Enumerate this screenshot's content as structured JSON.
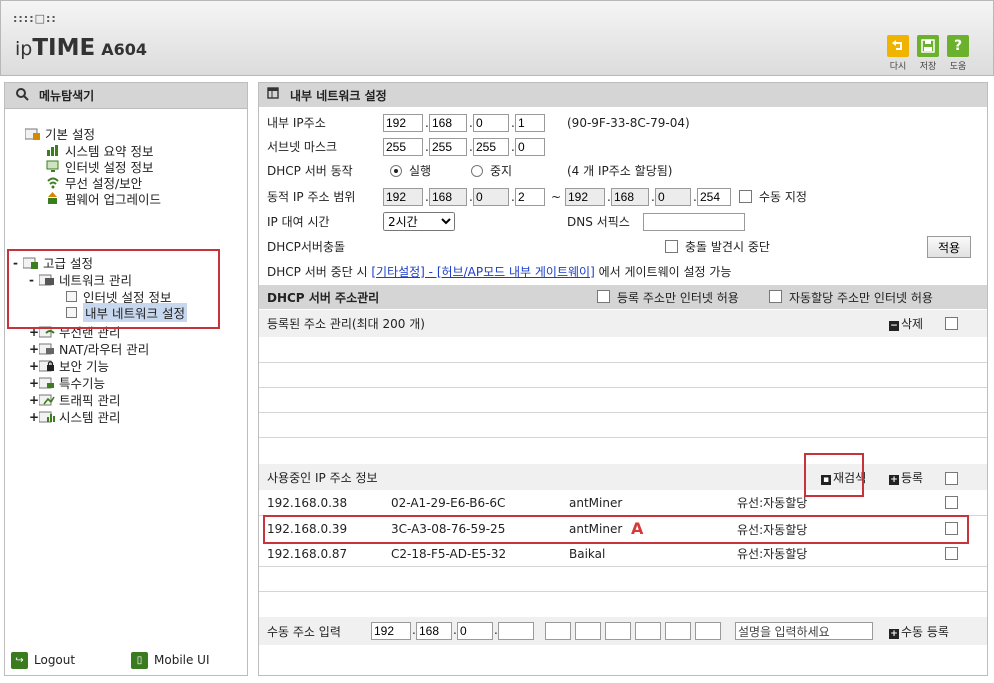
{
  "header": {
    "brand_dots": "::::□::",
    "brand_ip": "ip",
    "brand_time": "TIME",
    "brand_model": "A604",
    "buttons": [
      {
        "label": "다시",
        "icon": "undo-icon"
      },
      {
        "label": "저장",
        "icon": "save-icon"
      },
      {
        "label": "도움",
        "icon": "help-icon",
        "glyph": "?"
      }
    ]
  },
  "sidebar": {
    "title": "메뉴탐색기",
    "basic": {
      "label": "기본 설정",
      "items": [
        "시스템 요약 정보",
        "인터넷 설정 정보",
        "무선 설정/보안",
        "펌웨어 업그레이드"
      ]
    },
    "advanced": {
      "label": "고급 설정",
      "network": {
        "label": "네트워크 관리",
        "items": [
          "인터넷 설정 정보",
          "내부 네트워크 설정"
        ]
      },
      "others": [
        "무선랜 관리",
        "NAT/라우터 관리",
        "보안 기능",
        "특수기능",
        "트래픽 관리",
        "시스템 관리"
      ]
    },
    "footer": {
      "logout": "Logout",
      "mobile": "Mobile UI"
    }
  },
  "main": {
    "title": "내부 네트워크 설정",
    "lan_ip": {
      "label": "내부 IP주소",
      "octets": [
        "192",
        "168",
        "0",
        "1"
      ],
      "mac": "(90-9F-33-8C-79-04)"
    },
    "subnet": {
      "label": "서브넷 마스크",
      "octets": [
        "255",
        "255",
        "255",
        "0"
      ]
    },
    "dhcp": {
      "label": "DHCP 서버 동작",
      "on": "실행",
      "off": "중지",
      "note": "(4 개 IP주소 할당됨)"
    },
    "range": {
      "label": "동적 IP 주소 범위",
      "start": [
        "192",
        "168",
        "0",
        "2"
      ],
      "tilde": "~",
      "end": [
        "192",
        "168",
        "0",
        "254"
      ],
      "manual": "수동 지정"
    },
    "lease": {
      "label": "IP 대여 시간",
      "value": "2시간",
      "dns_label": "DNS 서픽스",
      "dns_value": ""
    },
    "conflict": {
      "label": "DHCP서버충돌",
      "stop_label": "충돌 발견시 중단",
      "apply": "적용"
    },
    "stop_note": {
      "prefix": "DHCP 서버 중단 시 ",
      "link": "[기타설정] - [허브/AP모드 내부 게이트웨이]",
      "suffix": " 에서 게이트웨이 설정 가능"
    },
    "addr_mgmt": {
      "title": "DHCP 서버 주소관리",
      "opt1": "등록 주소만 인터넷 허용",
      "opt2": "자동할당 주소만 인터넷 허용"
    },
    "registered": {
      "label": "등록된 주소 관리(최대 200 개)",
      "delete": "삭제"
    },
    "in_use": {
      "label": "사용중인 IP 주소 정보",
      "rescan": "재검색",
      "register": "등록",
      "rows": [
        {
          "ip": "192.168.0.38",
          "mac": "02-A1-29-E6-B6-6C",
          "name": "antMiner",
          "type": "유선:자동할당"
        },
        {
          "ip": "192.168.0.39",
          "mac": "3C-A3-08-76-59-25",
          "name": "antMiner",
          "type": "유선:자동할당"
        },
        {
          "ip": "192.168.0.87",
          "mac": "C2-18-F5-AD-E5-32",
          "name": "Baikal",
          "type": "유선:자동할당"
        }
      ],
      "annotation": "A"
    },
    "manual": {
      "label": "수동 주소 입력",
      "octets": [
        "192",
        "168",
        "0",
        ""
      ],
      "desc_placeholder": "설명을 입력하세요",
      "submit": "수동 등록"
    }
  }
}
